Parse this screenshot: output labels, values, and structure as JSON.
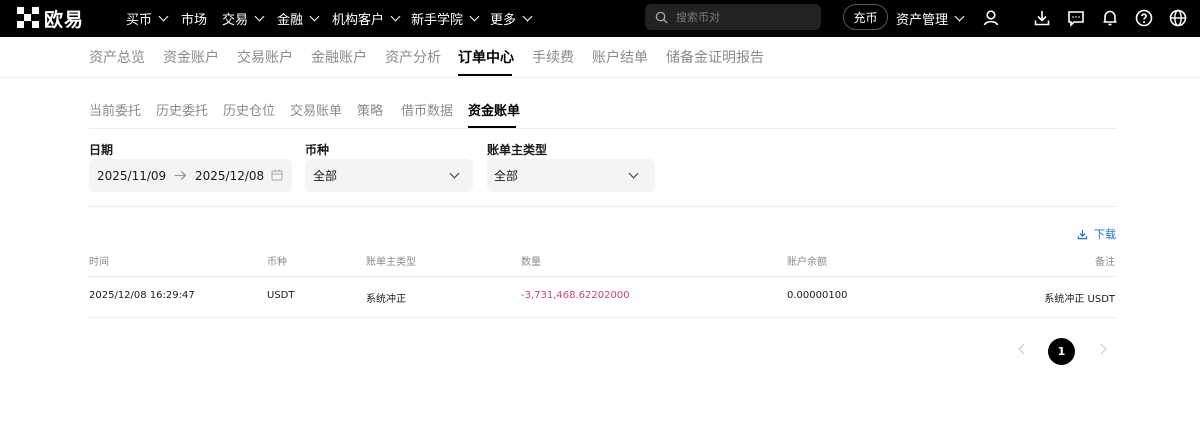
{
  "brand": {
    "name": "欧易",
    "logo_icon": "okx-logo-icon"
  },
  "topnav": {
    "items": [
      {
        "label": "买币",
        "dropdown": true
      },
      {
        "label": "市场",
        "dropdown": false
      },
      {
        "label": "交易",
        "dropdown": true
      },
      {
        "label": "金融",
        "dropdown": true
      },
      {
        "label": "机构客户",
        "dropdown": true
      },
      {
        "label": "新手学院",
        "dropdown": true
      },
      {
        "label": "更多",
        "dropdown": true
      }
    ],
    "search_placeholder": "搜索币对",
    "deposit_label": "充币",
    "asset_mgmt_label": "资产管理",
    "icons": [
      "user-icon",
      "download-icon",
      "message-icon",
      "bell-icon",
      "help-icon",
      "globe-icon"
    ]
  },
  "account_tabs": {
    "items": [
      "资产总览",
      "资金账户",
      "交易账户",
      "金融账户",
      "资产分析",
      "订单中心",
      "手续费",
      "账户结单",
      "储备金证明报告"
    ],
    "active": "订单中心"
  },
  "sub_tabs": {
    "items": [
      "当前委托",
      "历史委托",
      "历史仓位",
      "交易账单",
      "策略",
      "借币数据",
      "资金账单"
    ],
    "active": "资金账单"
  },
  "filters": {
    "date": {
      "label": "日期",
      "start": "2025/11/09",
      "end": "2025/12/08"
    },
    "currency": {
      "label": "币种",
      "value": "全部"
    },
    "bill_type": {
      "label": "账单主类型",
      "value": "全部"
    }
  },
  "download_label": "下载",
  "table": {
    "headers": [
      "时间",
      "币种",
      "账单主类型",
      "数量",
      "账户余额",
      "备注"
    ],
    "rows": [
      {
        "time": "2025/12/08 16:29:47",
        "currency": "USDT",
        "type": "系统冲正",
        "amount": "-3,731,468.62202000",
        "balance": "0.00000100",
        "note": "系统冲正 USDT"
      }
    ]
  },
  "pagination": {
    "current": "1"
  },
  "colors": {
    "negative": "#c9486f",
    "link": "#1f6fd9",
    "accent": "#000000"
  }
}
